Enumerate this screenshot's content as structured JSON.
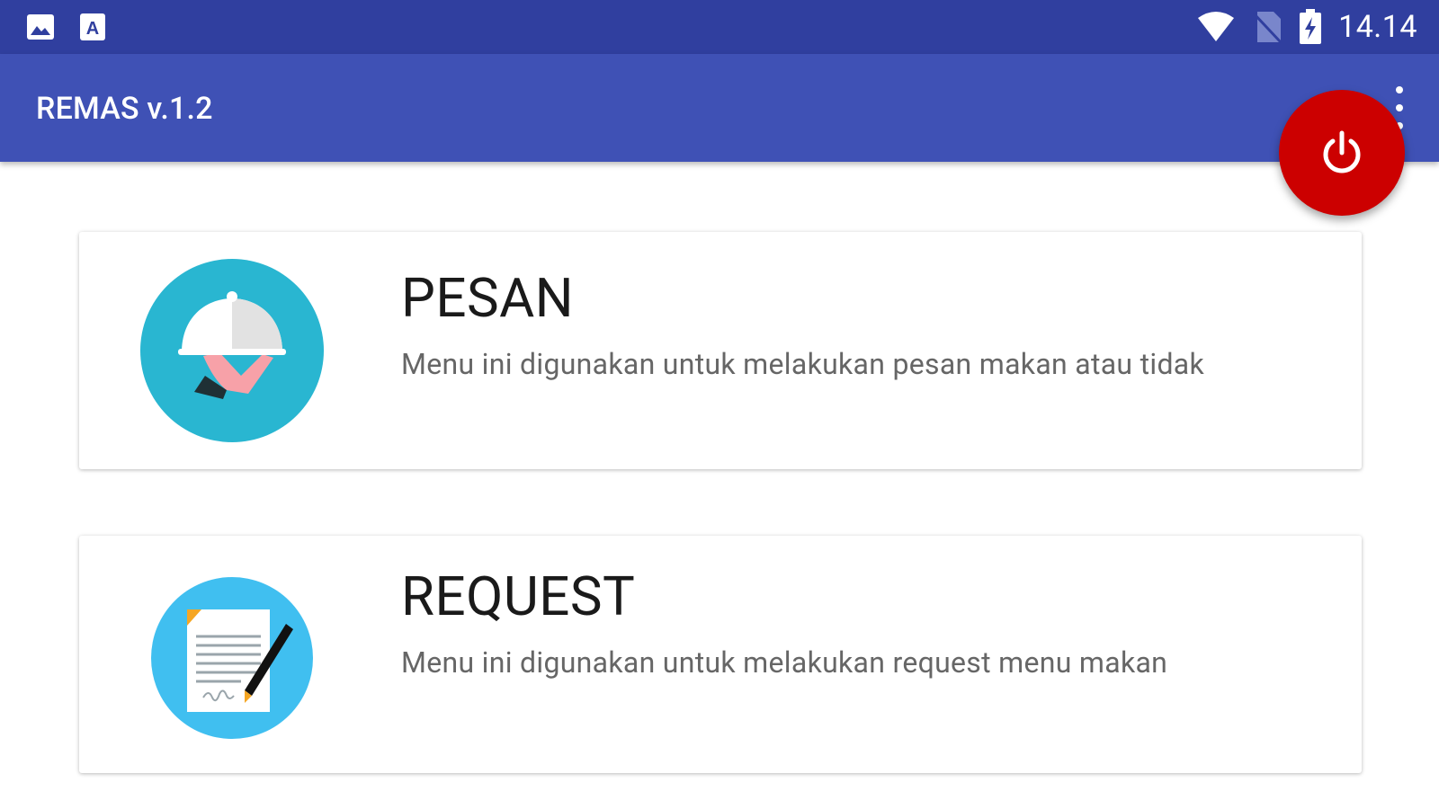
{
  "status_bar": {
    "left_icons": [
      "image-icon",
      "font-a-icon"
    ],
    "right_icons": [
      "wifi-icon",
      "no-sim-icon",
      "battery-charging-icon"
    ],
    "time": "14.14",
    "background": "#303f9f"
  },
  "app_bar": {
    "title": "REMAS v.1.2",
    "background": "#3f51b5",
    "overflow_icon": "more-vert-icon"
  },
  "fab": {
    "icon": "power-icon",
    "color": "#cc0000"
  },
  "menu_cards": [
    {
      "title": "PESAN",
      "description": "Menu ini digunakan untuk melakukan pesan makan atau tidak",
      "icon": "food-cloche-icon",
      "icon_color": "#29b6d1"
    },
    {
      "title": "REQUEST",
      "description": "Menu ini digunakan untuk melakukan request menu makan",
      "icon": "document-pen-icon",
      "icon_color": "#40bff0"
    }
  ]
}
